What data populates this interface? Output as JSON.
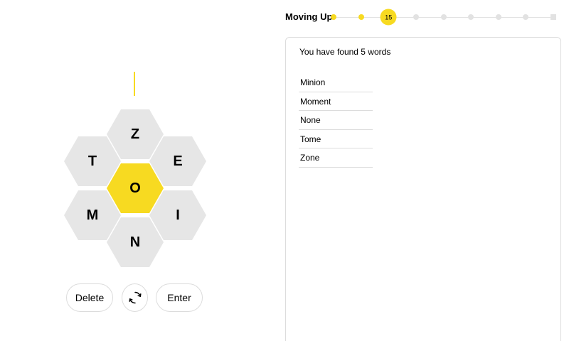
{
  "puzzle": {
    "input_text": "",
    "center_letter": "o",
    "outer_letters": [
      "z",
      "e",
      "i",
      "n",
      "m",
      "t"
    ]
  },
  "controls": {
    "delete_label": "Delete",
    "shuffle_icon": "shuffle-icon",
    "enter_label": "Enter"
  },
  "progress": {
    "rank": "Moving Up",
    "score": "15",
    "levels_total": 9,
    "current_level_index": 2
  },
  "words": {
    "summary": "You have found 5 words",
    "list": [
      "Minion",
      "Moment",
      "None",
      "Tome",
      "Zone"
    ]
  },
  "colors": {
    "accent": "#f7da21",
    "cell": "#e6e6e6",
    "border": "#dcdcdc"
  }
}
